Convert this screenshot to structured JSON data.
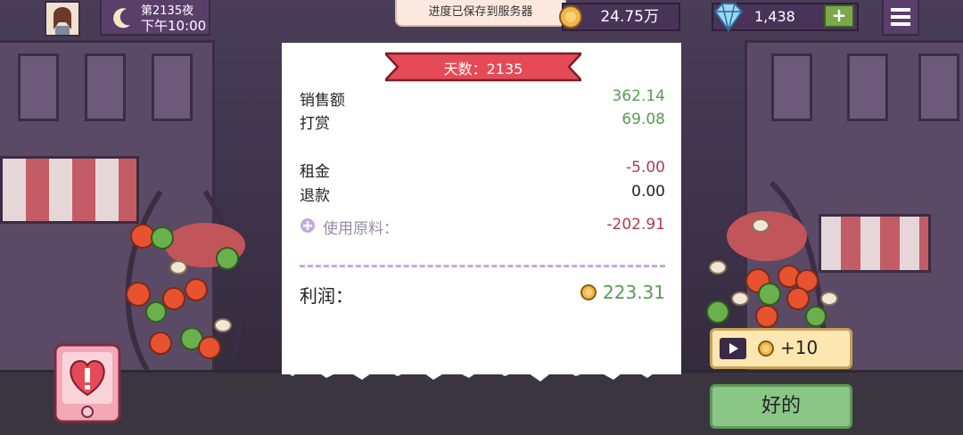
{
  "top": {
    "night_label": "第2135夜",
    "time_label": "下午10:00",
    "save_toast": "进度已保存到服务器",
    "coins": "24.75万",
    "gems": "1,438",
    "add_gems_symbol": "+"
  },
  "receipt": {
    "day_banner": "天数：2135",
    "sales_label": "销售额",
    "sales_value": "362.14",
    "tips_label": "打赏",
    "tips_value": "69.08",
    "rent_label": "租金",
    "rent_value": "-5.00",
    "refund_label": "退款",
    "refund_value": "0.00",
    "ingredients_label": "使用原料：",
    "ingredients_value": "-202.91",
    "profit_label": "利润：",
    "profit_value": "223.31"
  },
  "buttons": {
    "ad_reward": "+10",
    "ok": "好的"
  },
  "colors": {
    "positive": "#5a9a55",
    "negative": "#b23a4e",
    "neutral": "#222222",
    "banner_red": "#e64a57",
    "accent_purple": "#c4a8dc"
  },
  "icons": [
    "avatar",
    "moon-icon",
    "coin-icon",
    "diamond-icon",
    "plus-icon",
    "menu-icon",
    "expand-icon",
    "play-icon",
    "heart-alert-icon"
  ]
}
